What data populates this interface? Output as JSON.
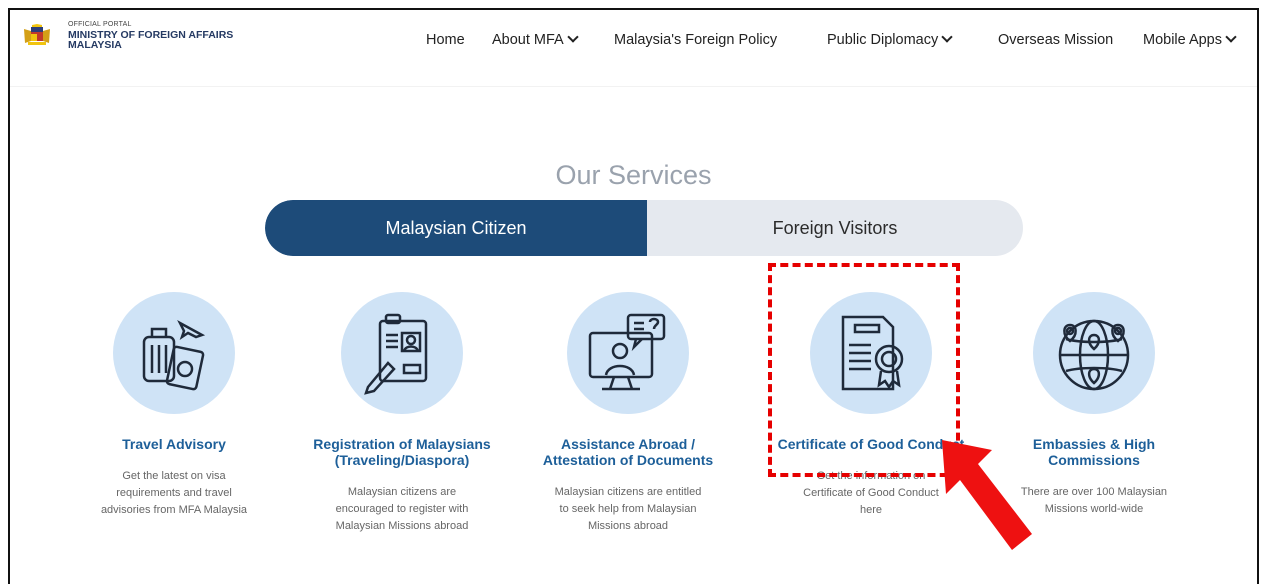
{
  "brand": {
    "small": "OFFICIAL PORTAL",
    "line1": "MINISTRY OF FOREIGN AFFAIRS",
    "line2": "MALAYSIA"
  },
  "nav": {
    "items": [
      {
        "label": "Home"
      },
      {
        "label": "About MFA"
      },
      {
        "label": "Malaysia's Foreign Policy"
      },
      {
        "label": "Public Diplomacy"
      },
      {
        "label": "Overseas Mission"
      },
      {
        "label": "Mobile Apps"
      }
    ]
  },
  "main": {
    "title": "Our Services",
    "tabs": [
      {
        "label": "Malaysian Citizen"
      },
      {
        "label": "Foreign Visitors"
      }
    ],
    "services": [
      {
        "title": "Travel Advisory",
        "desc": "Get the latest on visa requirements and travel advisories from MFA Malaysia"
      },
      {
        "title": "Registration of Malaysians (Traveling/Diaspora)",
        "desc": "Malaysian citizens are encouraged to register with Malaysian Missions abroad"
      },
      {
        "title": "Assistance Abroad / Attestation of Documents",
        "desc": "Malaysian citizens are entitled to seek help from Malaysian Missions abroad"
      },
      {
        "title": "Certificate of Good Conduct",
        "desc": "Get the information on Certificate of Good Conduct here"
      },
      {
        "title": "Embassies & High Commissions",
        "desc": "There are over 100 Malaysian Missions world-wide"
      }
    ]
  },
  "colors": {
    "accent": "#1d4b79",
    "link": "#1d5f99",
    "highlight": "#e60000",
    "circle": "#cfe3f6"
  },
  "icons": [
    "crest-icon",
    "luggage-passport-icon",
    "registration-card-icon",
    "assistance-monitor-icon",
    "certificate-icon",
    "globe-pins-icon",
    "arrow-icon"
  ]
}
